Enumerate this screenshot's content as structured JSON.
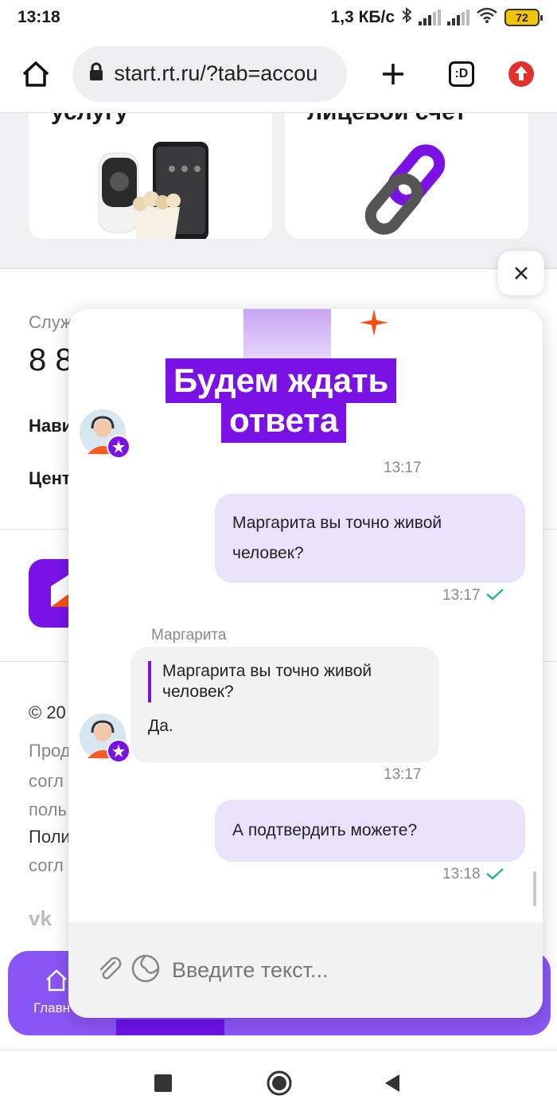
{
  "status_bar": {
    "time": "13:18",
    "network_speed": "1,3 КБ/с",
    "battery": "72",
    "icons": [
      "bluetooth-icon",
      "signal-icon",
      "wifi-icon",
      "battery-icon"
    ]
  },
  "browser": {
    "url": "start.rt.ru/?tab=accou",
    "tab_counter": ":D",
    "icons": [
      "home-icon",
      "lock-icon",
      "plus-icon",
      "tabs-icon",
      "update-icon"
    ]
  },
  "background_page": {
    "card_left_title": "услугу",
    "card_right_title": "лицевой счет",
    "support_label": "Служ",
    "support_phone": "8 8",
    "nav_link_1": "Нави",
    "nav_link_2": "Цент",
    "copyright": "© 20",
    "legal_line_1": "Прод",
    "legal_line_2": "согл",
    "legal_line_3": "поль",
    "legal_line_4": "Поли",
    "legal_line_5": "согл",
    "bottom_nav_home": "Главн"
  },
  "chat": {
    "sticker_line_1": "Будем ждать",
    "sticker_line_2": "ответа",
    "sticker_time": "13:17",
    "messages": [
      {
        "direction": "out",
        "text": "Маргарита вы точно живой человек?",
        "time": "13:17"
      },
      {
        "direction": "in",
        "sender": "Маргарита",
        "quote": "Маргарита вы точно живой человек?",
        "text": "Да.",
        "time": "13:17"
      },
      {
        "direction": "out",
        "text": "А подтвердить можете?",
        "time": "13:18"
      }
    ],
    "input_placeholder": "Введите текст...",
    "colors": {
      "accent": "#7a12e6",
      "outgoing_bubble": "#e9e2fb",
      "incoming_bubble": "#f2f2f2",
      "read_check": "#2bb19a"
    }
  }
}
